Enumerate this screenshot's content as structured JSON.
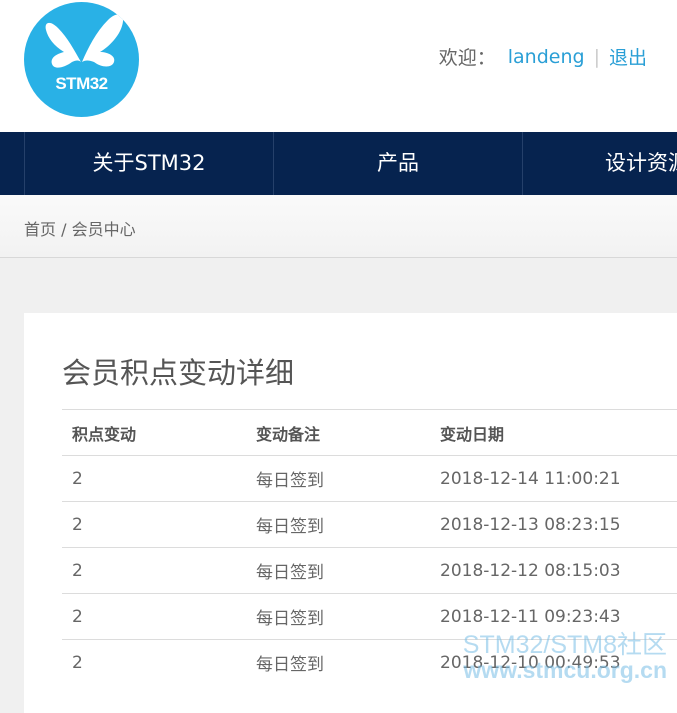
{
  "brand": {
    "logo_text": "STM32"
  },
  "user": {
    "welcome": "欢迎：",
    "username": "landeng",
    "separator": "|",
    "logout": "退出"
  },
  "nav": {
    "items": [
      "关于STM32",
      "产品",
      "设计资源"
    ]
  },
  "breadcrumb": {
    "home": "首页",
    "separator": " / ",
    "current": "会员中心"
  },
  "main": {
    "title": "会员积点变动详细",
    "columns": [
      "积点变动",
      "变动备注",
      "变动日期"
    ],
    "rows": [
      [
        "2",
        "每日签到",
        "2018-12-14 11:00:21"
      ],
      [
        "2",
        "每日签到",
        "2018-12-13 08:23:15"
      ],
      [
        "2",
        "每日签到",
        "2018-12-12 08:15:03"
      ],
      [
        "2",
        "每日签到",
        "2018-12-11 09:23:43"
      ],
      [
        "2",
        "每日签到",
        "2018-12-10 00:49:53"
      ]
    ]
  },
  "watermark": {
    "line1": "STM32/STM8社区",
    "line2": "www.stmcu.org.cn"
  },
  "colors": {
    "nav_bg": "#06234f",
    "logo_bg": "#29b1e6",
    "link": "#2a9fd6"
  }
}
